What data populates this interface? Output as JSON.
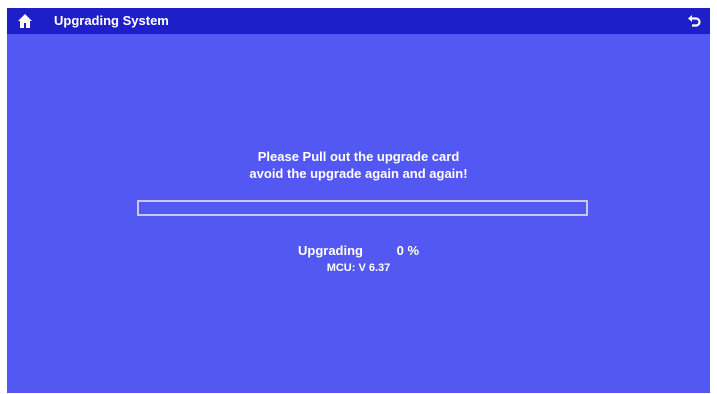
{
  "title_bar": {
    "title": "Upgrading System",
    "home_icon": "home-icon",
    "back_icon": "back-arrow-icon"
  },
  "message": {
    "line1": "Please Pull out the upgrade card",
    "line2": "avoid the upgrade again and again!"
  },
  "progress": {
    "value": 0,
    "label": "Upgrading",
    "percent_text": "0 %"
  },
  "mcu": {
    "version_text": "MCU: V 6.37"
  },
  "colors": {
    "background": "#5358f2",
    "title_bar": "#1f1fc8",
    "text": "#ffffff"
  }
}
